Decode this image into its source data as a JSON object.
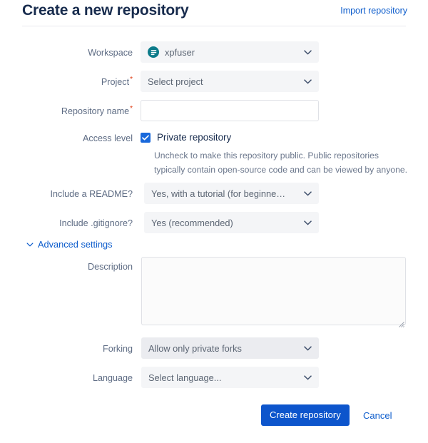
{
  "header": {
    "title": "Create a new repository",
    "import_link": "Import repository"
  },
  "colors": {
    "primary_blue": "#0d55cc",
    "link_blue": "#0c5ccc",
    "checkbox_blue": "#1868db",
    "required_red": "#de350b",
    "avatar_teal": "#0c7b8a",
    "label_gray": "#5e6c84",
    "field_bg": "#f4f5f7",
    "field_bg_dim": "#ebecf0"
  },
  "form": {
    "workspace": {
      "label": "Workspace",
      "value": "xpfuser",
      "avatar_icon": "workspace-avatar-icon",
      "chevron_icon": "chevron-down-icon",
      "required": false
    },
    "project": {
      "label": "Project",
      "value": "Select project",
      "chevron_icon": "chevron-down-icon",
      "required": true,
      "required_marker": "*"
    },
    "repository_name": {
      "label": "Repository name",
      "value": "",
      "placeholder": "",
      "required": true,
      "required_marker": "*"
    },
    "access_level": {
      "label": "Access level",
      "checkbox_label": "Private repository",
      "checked": true,
      "check_icon": "check-icon",
      "help_line_1": "Uncheck to make this repository public. Public repositories",
      "help_line_2": "typically contain open-source code and can be viewed by anyone."
    },
    "readme": {
      "label": "Include a README?",
      "value": "Yes, with a tutorial (for beginne…",
      "chevron_icon": "chevron-down-icon"
    },
    "gitignore": {
      "label": "Include .gitignore?",
      "value": "Yes (recommended)",
      "chevron_icon": "chevron-down-icon"
    },
    "advanced_settings": {
      "label": "Advanced settings",
      "expanded": true,
      "chevron_icon": "chevron-down-icon"
    },
    "description": {
      "label": "Description",
      "value": "",
      "placeholder": ""
    },
    "forking": {
      "label": "Forking",
      "value": "Allow only private forks",
      "chevron_icon": "chevron-down-icon"
    },
    "language": {
      "label": "Language",
      "value": "Select language...",
      "chevron_icon": "chevron-down-icon"
    }
  },
  "footer": {
    "submit_label": "Create repository",
    "cancel_label": "Cancel"
  }
}
